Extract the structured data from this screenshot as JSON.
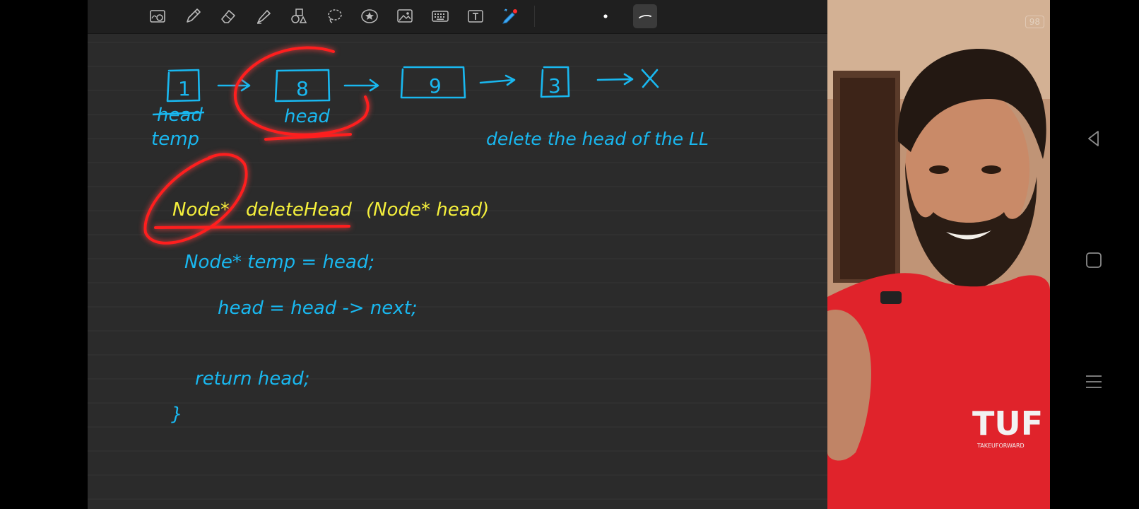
{
  "toolbar": {
    "tools": [
      {
        "name": "zoom-box-icon"
      },
      {
        "name": "pen-icon"
      },
      {
        "name": "eraser-icon"
      },
      {
        "name": "highlighter-icon"
      },
      {
        "name": "shapes-icon"
      },
      {
        "name": "lasso-icon"
      },
      {
        "name": "elements-icon"
      },
      {
        "name": "image-icon"
      },
      {
        "name": "keyboard-icon"
      },
      {
        "name": "text-box-icon"
      },
      {
        "name": "laser-pointer-icon"
      }
    ],
    "pen_dot_color": "#ffffff",
    "active_stroke_color": "#ffffff"
  },
  "note": {
    "nodes": [
      {
        "value": "1"
      },
      {
        "value": "8"
      },
      {
        "value": "9"
      },
      {
        "value": "3"
      }
    ],
    "terminator": "X",
    "struck_label": "head",
    "temp_label": "temp",
    "head_label": "head",
    "task_text": "delete the head of the LL",
    "function_signature": {
      "return_type": "Node*",
      "name": "deleteHead",
      "params": "(Node* head)"
    },
    "code_lines": [
      "Node* temp = head;",
      "head = head -> next;",
      "return head;",
      "}"
    ]
  },
  "colors": {
    "ink_blue": "#19b8f0",
    "ink_yellow": "#f5f03c",
    "laser_red": "#ff1e1e",
    "paper": "#2b2b2b",
    "ruled_line": "#333333"
  },
  "camera": {
    "badge": "98",
    "shirt_text": "TUF",
    "shirt_subtext": "TAKEUFORWARD"
  },
  "system_nav": [
    {
      "name": "back-icon"
    },
    {
      "name": "home-icon"
    },
    {
      "name": "recents-icon"
    }
  ]
}
